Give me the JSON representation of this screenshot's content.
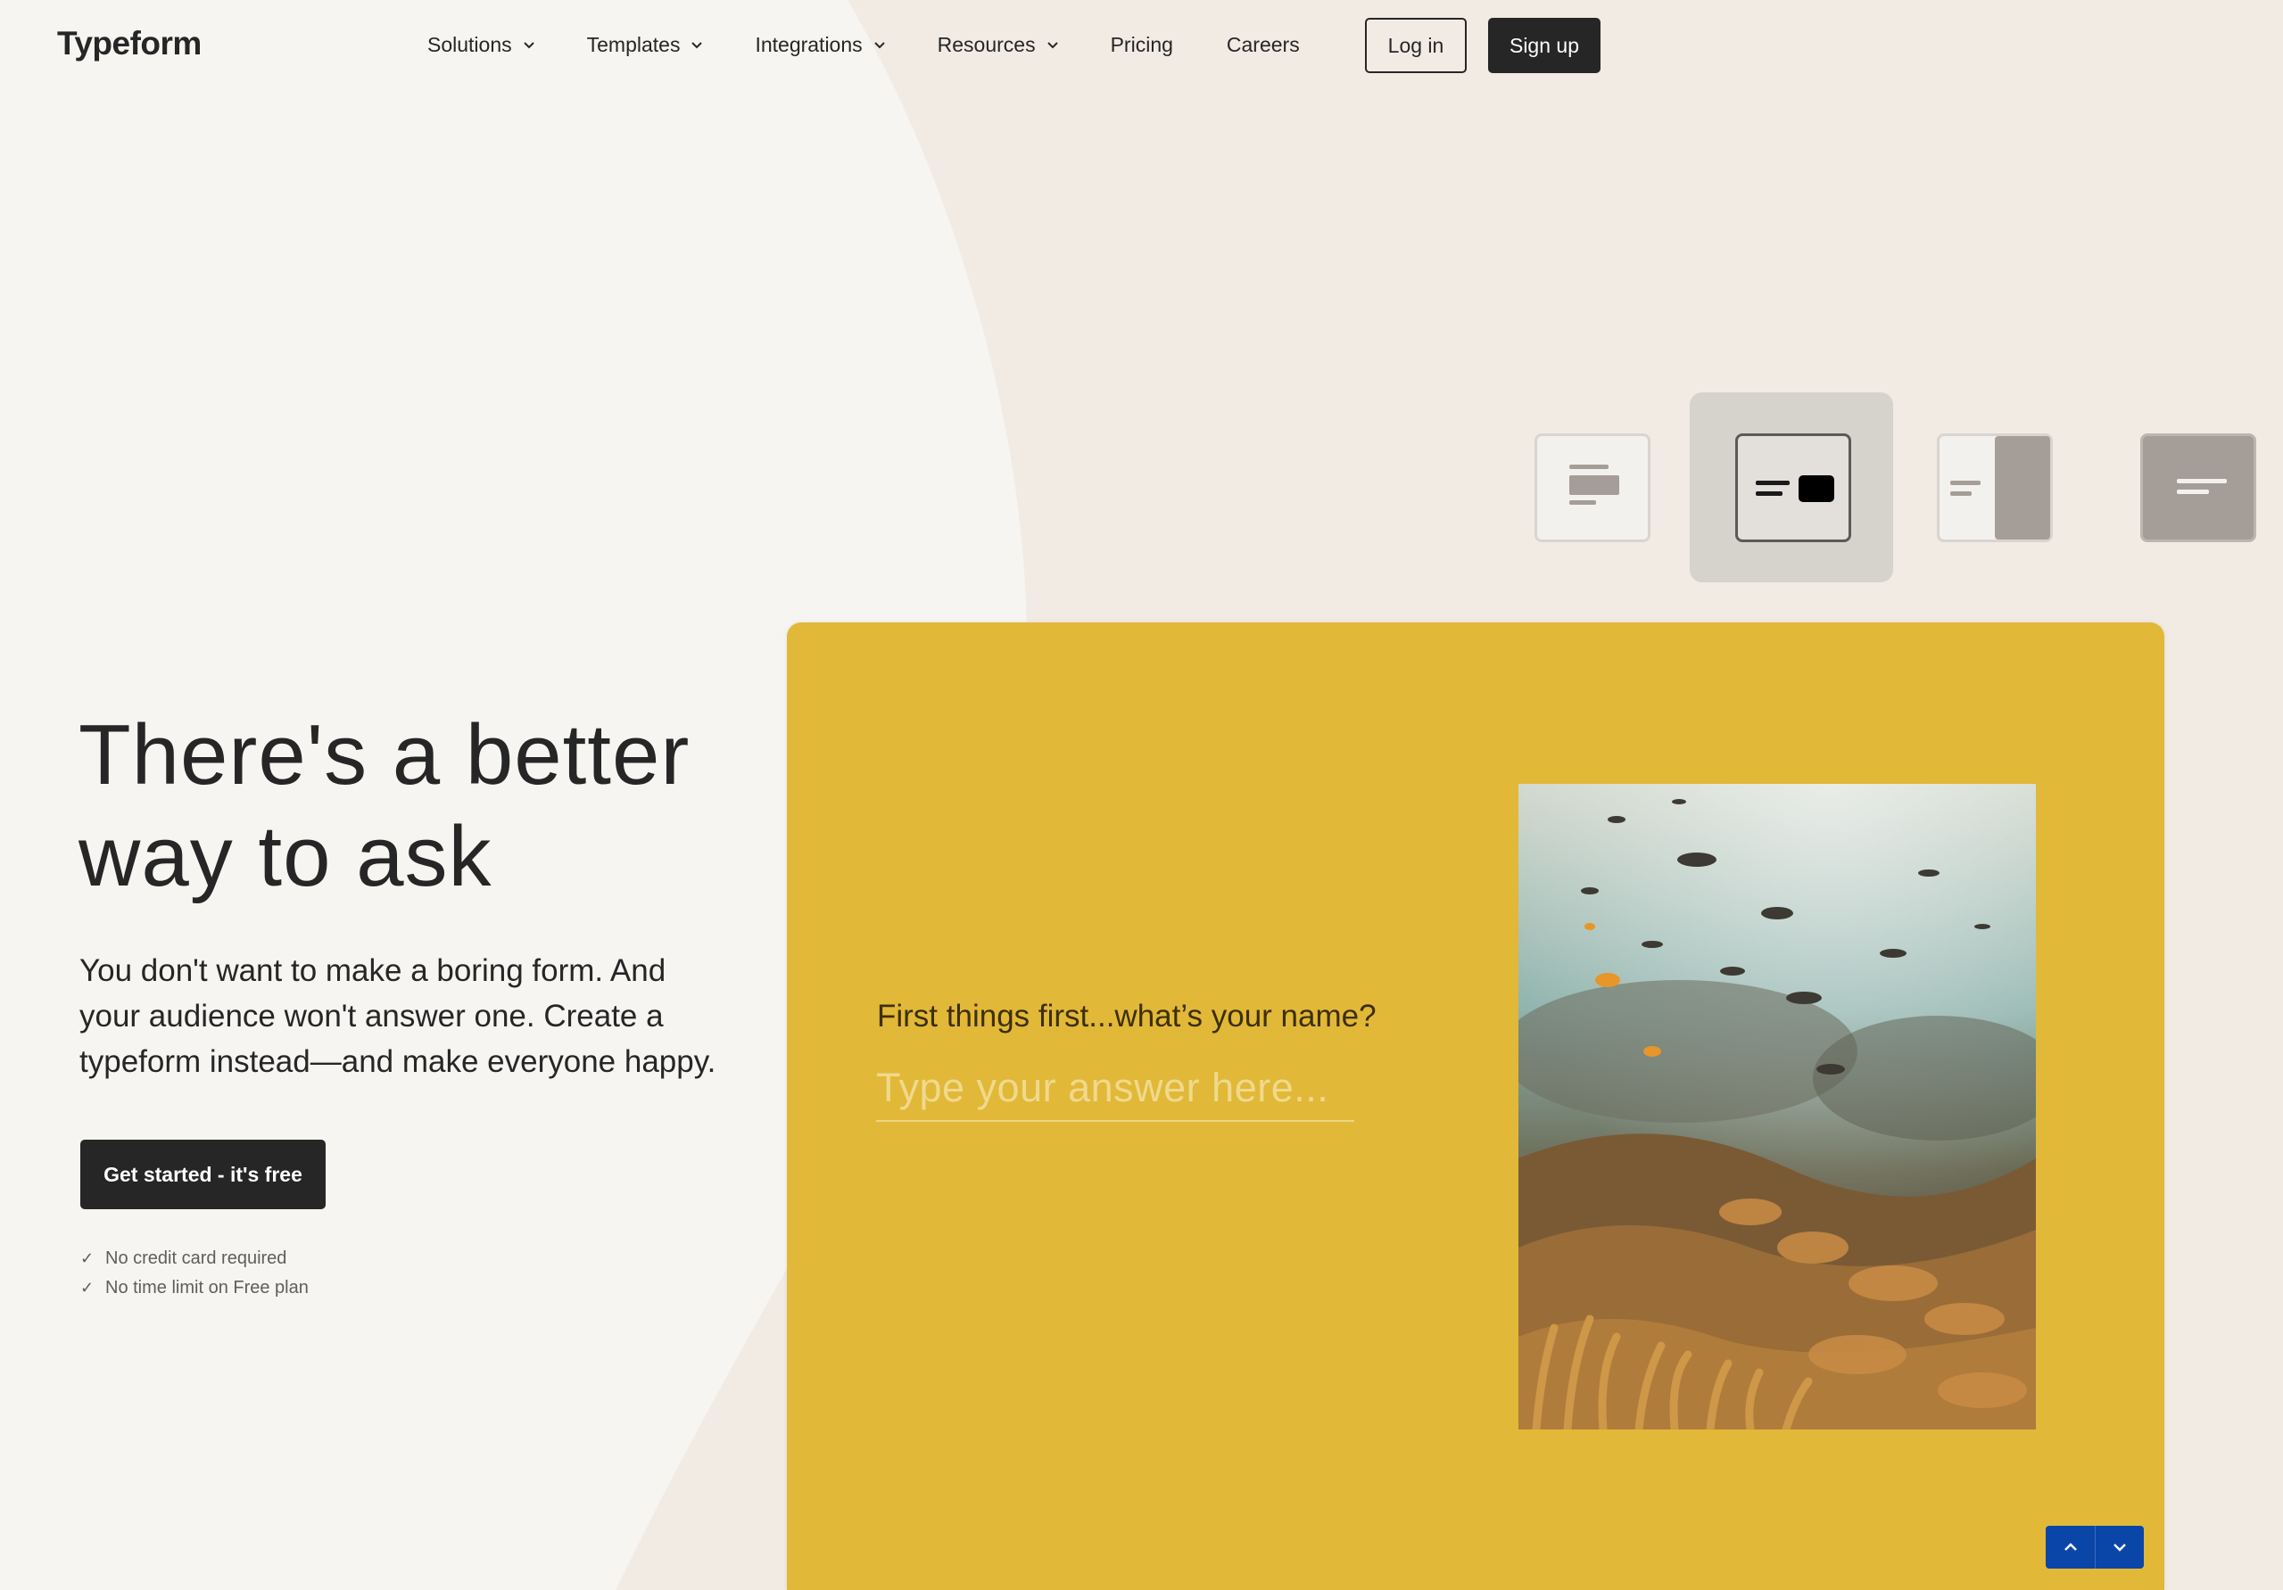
{
  "brand": {
    "logo": "Typeform"
  },
  "nav": {
    "items": [
      {
        "label": "Solutions",
        "dropdown": true
      },
      {
        "label": "Templates",
        "dropdown": true
      },
      {
        "label": "Integrations",
        "dropdown": true
      },
      {
        "label": "Resources",
        "dropdown": true
      },
      {
        "label": "Pricing",
        "dropdown": false
      },
      {
        "label": "Careers",
        "dropdown": false
      }
    ],
    "login_label": "Log in",
    "signup_label": "Sign up"
  },
  "hero": {
    "title_line1": "There's a better",
    "title_line2": "way to ask",
    "subtitle_line1": "You don't want to make a boring form. And",
    "subtitle_line2": "your audience won't answer one. Create a",
    "subtitle_line3": "typeform instead—and make everyone happy.",
    "cta_label": "Get started - it's free",
    "checks": [
      "No credit card required",
      "No time limit on Free plan"
    ]
  },
  "preview": {
    "question": "First things first...what’s your name?",
    "answer_placeholder": "Type your answer here...",
    "layout_options": [
      "layout-stack-icon",
      "layout-split-icon",
      "layout-right-image-icon",
      "layout-full-image-icon"
    ],
    "selected_layout": 1
  },
  "colors": {
    "background": "#f6f5f1",
    "accent_shape": "#f2ebe4",
    "dark": "#262627",
    "form_yellow": "#e1b838",
    "nav_blue": "#0a46a8"
  }
}
